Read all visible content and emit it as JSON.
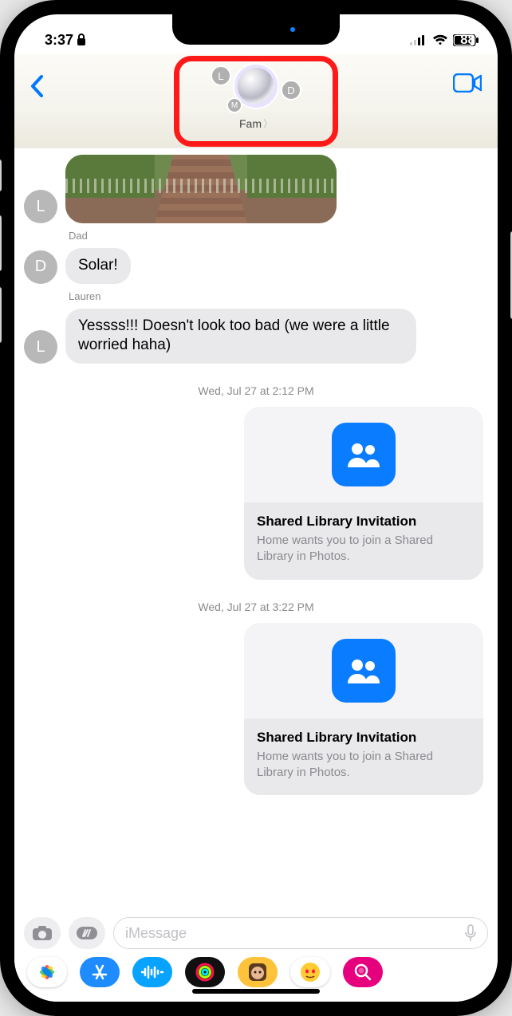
{
  "status": {
    "time": "3:37",
    "battery_pct": "88"
  },
  "nav": {
    "group_name": "Fam",
    "ga_l": "L",
    "ga_d": "D",
    "ga_m": "M"
  },
  "chat": {
    "msg1_avatar": "L",
    "msg2_sender": "Dad",
    "msg2_avatar": "D",
    "msg2_text": "Solar!",
    "msg3_sender": "Lauren",
    "msg3_avatar": "L",
    "msg3_text": "Yessss!!! Doesn't look too bad (we were a little worried haha)",
    "ts1": "Wed, Jul 27 at 2:12 PM",
    "card1_title": "Shared Library Invitation",
    "card1_sub": "Home wants you to join a Shared Library in Photos.",
    "ts2": "Wed, Jul 27 at 3:22 PM",
    "card2_title": "Shared Library Invitation",
    "card2_sub": "Home wants you to join a Shared Library in Photos."
  },
  "composer": {
    "placeholder": "iMessage"
  }
}
